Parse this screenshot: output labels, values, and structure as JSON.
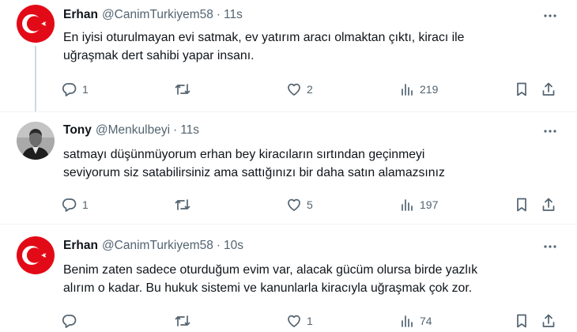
{
  "tweets": [
    {
      "name": "Erhan",
      "handle": "@CanimTurkiyem58",
      "separator": "·",
      "time": "11s",
      "text_lines": [
        "En iyisi oturulmayan evi satmak, ev yatırım aracı olmaktan çıktı, kiracı ile",
        "uğraşmak dert sahibi yapar insanı."
      ],
      "replies": "1",
      "retweets": "",
      "likes": "2",
      "views": "219",
      "avatar": "turkish-flag-avatar"
    },
    {
      "name": "Tony",
      "handle": "@Menkulbeyi",
      "separator": "·",
      "time": "11s",
      "text_lines": [
        "satmayı düşünmüyorum erhan bey kiracıların sırtından geçinmeyi",
        "seviyorum siz satabilirsiniz ama sattığınızı bir daha satın alamazsınız"
      ],
      "replies": "1",
      "retweets": "",
      "likes": "5",
      "views": "197",
      "avatar": "man-in-suit-photo-avatar"
    },
    {
      "name": "Erhan",
      "handle": "@CanimTurkiyem58",
      "separator": "·",
      "time": "10s",
      "text_lines": [
        "Benim zaten sadece  oturduğum evim var, alacak gücüm olursa birde yazlık",
        "alırım o kadar. Bu hukuk sistemi ve kanunlarla kiracıyla uğraşmak çok zor."
      ],
      "replies": "",
      "retweets": "",
      "likes": "1",
      "views": "74",
      "avatar": "turkish-flag-avatar"
    }
  ],
  "icons": {
    "reply": "reply-icon",
    "retweet": "retweet-icon",
    "like": "heart-icon",
    "views": "views-chart-icon",
    "bookmark": "bookmark-icon",
    "share": "share-icon",
    "more": "more-dots-icon"
  },
  "colors": {
    "text": "#0f1419",
    "secondary": "#536471",
    "divider": "#eff3f4",
    "thread_line": "#cfd9de",
    "flag_red": "#e30a17"
  }
}
